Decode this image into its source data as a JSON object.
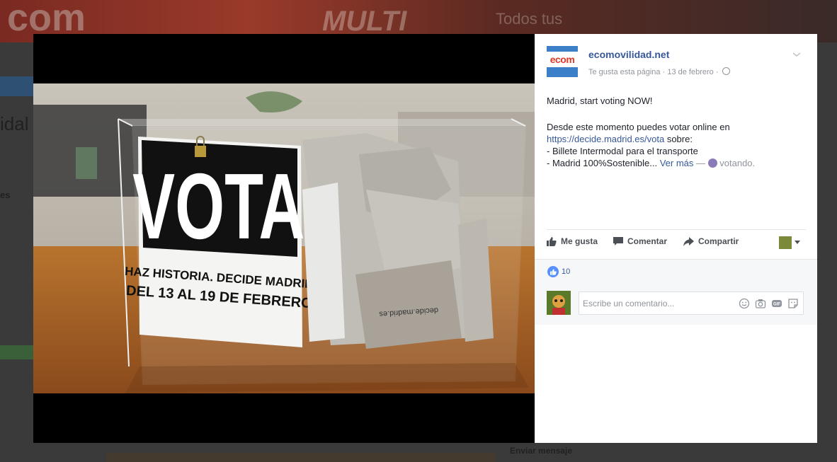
{
  "background_page": {
    "banner_text_1": "com",
    "banner_text_2": "MULTI",
    "banner_text_3": "Todos tus",
    "side_text_1": "idal",
    "side_text_2": "es",
    "bottom_text": "Enviar mensaje"
  },
  "photo": {
    "sign_main": "VOTA",
    "sign_line_1": "HAZ HISTORIA. DECIDE MADRID",
    "sign_line_2": "DEL 13 AL 19 DE FEBRERO",
    "envelope_text": "decide.madrid.es"
  },
  "post": {
    "logo_text": "ecom",
    "page_name": "ecomovilidad.net",
    "meta_like": "Te gusta esta página",
    "meta_date": "13 de febrero",
    "line1": "Madrid, start voting NOW!",
    "line2_prefix": "Desde este momento puedes votar online en",
    "link": "https://decide.madrid.es/vota",
    "line2_suffix": " sobre:",
    "bullet1": "- Billete Intermodal para el transporte",
    "bullet2": "- Madrid 100%Sostenible...",
    "see_more": "Ver más",
    "feeling_dash": " — ",
    "feeling": "votando."
  },
  "actions": {
    "like": "Me gusta",
    "comment": "Comentar",
    "share": "Compartir"
  },
  "likes_count": "10",
  "comment_placeholder": "Escribe un comentario...",
  "colors": {
    "link": "#365899",
    "like_blue": "#5890ff",
    "logo_blue": "#3a7fc8",
    "logo_red": "#e03a2a"
  }
}
